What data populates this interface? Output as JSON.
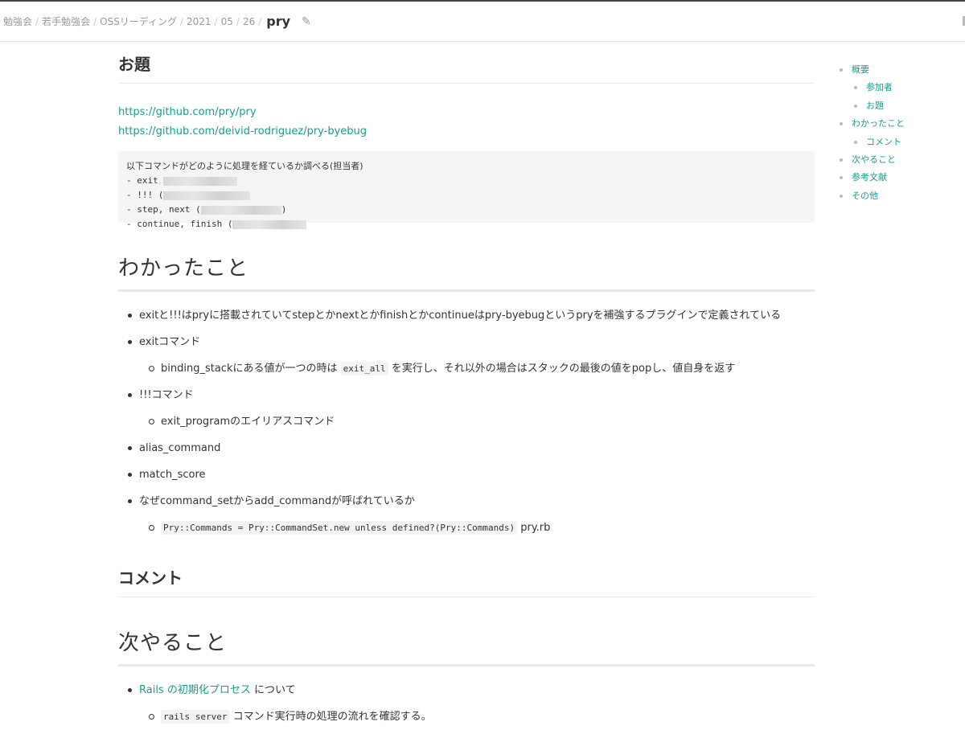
{
  "breadcrumb": {
    "items": [
      "勉強会",
      "若手勉強会",
      "OSSリーディング",
      "2021",
      "05",
      "26"
    ],
    "current": "pry",
    "separator": "/"
  },
  "icons": {
    "edit": "pencil-icon"
  },
  "content": {
    "section_odai": {
      "heading": "お題",
      "links": [
        "https://github.com/pry/pry",
        "https://github.com/deivid-rodriguez/pry-byebug"
      ],
      "code_lines": [
        "以下コマンドがどのように処理を経ているか調べる(担当者)",
        "- exit",
        "- !!! (",
        "- step, next (",
        ")",
        "- continue, finish ("
      ]
    },
    "section_wakatta": {
      "heading": "わかったこと",
      "item1": "exitと!!!はpryに搭載されていてstepとかnextとかfinishとかcontinueはpry-byebugというpryを補強するプラグインで定義されている",
      "item2": "exitコマンド",
      "item2_sub_before": "binding_stackにある値が一つの時は",
      "item2_sub_code": "exit_all",
      "item2_sub_after": "を実行し、それ以外の場合はスタックの最後の値をpopし、値自身を返す",
      "item3": "!!!コマンド",
      "item3_sub": "exit_programのエイリアスコマンド",
      "item4": "alias_command",
      "item5": "match_score",
      "item6": "なぜcommand_setからadd_commandが呼ばれているか",
      "item6_sub_code": "Pry::Commands = Pry::CommandSet.new unless defined?(Pry::Commands)",
      "item6_sub_after": "pry.rb"
    },
    "section_comment": {
      "heading": "コメント"
    },
    "section_next": {
      "heading": "次やること",
      "item1_link": "Rails の初期化プロセス",
      "item1_after": "について",
      "item1_sub_code": "rails server",
      "item1_sub_after": "コマンド実行時の処理の流れを確認する。"
    }
  },
  "toc": {
    "items": [
      "概要",
      "参加者",
      "お題",
      "わかったこと",
      "コメント",
      "次やること",
      "参考文献",
      "その他"
    ]
  },
  "colors": {
    "link": "#1a9b8f",
    "text": "#333333",
    "muted": "#999999"
  }
}
